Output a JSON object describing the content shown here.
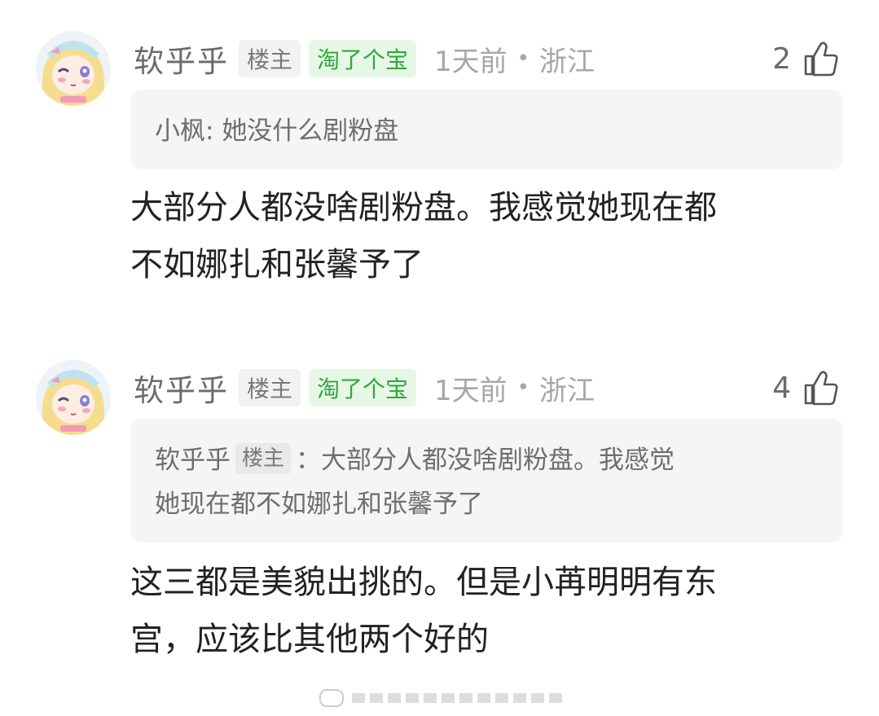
{
  "comments": [
    {
      "username": "软乎乎",
      "op_tag": "楼主",
      "badge": "淘了个宝",
      "time": "1天前",
      "location": "浙江",
      "likes": "2",
      "quote_author": "小枫",
      "quote_sep": ": ",
      "quote_text": "她没什么剧粉盘",
      "text_line1": "大部分人都没啥剧粉盘。我感觉她现在都",
      "text_line2": "不如娜扎和张馨予了"
    },
    {
      "username": "软乎乎",
      "op_tag": "楼主",
      "badge": "淘了个宝",
      "time": "1天前",
      "location": "浙江",
      "likes": "4",
      "quote_author": "软乎乎",
      "quote_op_tag": "楼主",
      "quote_text_line1": "：大部分人都没啥剧粉盘。我感觉",
      "quote_text_line2": "她现在都不如娜扎和张馨予了",
      "text_line1": "这三都是美貌出挑的。但是小苒明明有东",
      "text_line2": "宫，应该比其他两个好的"
    }
  ],
  "separator_dot": "•",
  "icons": {
    "like": "thumbs-up-icon",
    "avatar": "anime-avatar"
  }
}
